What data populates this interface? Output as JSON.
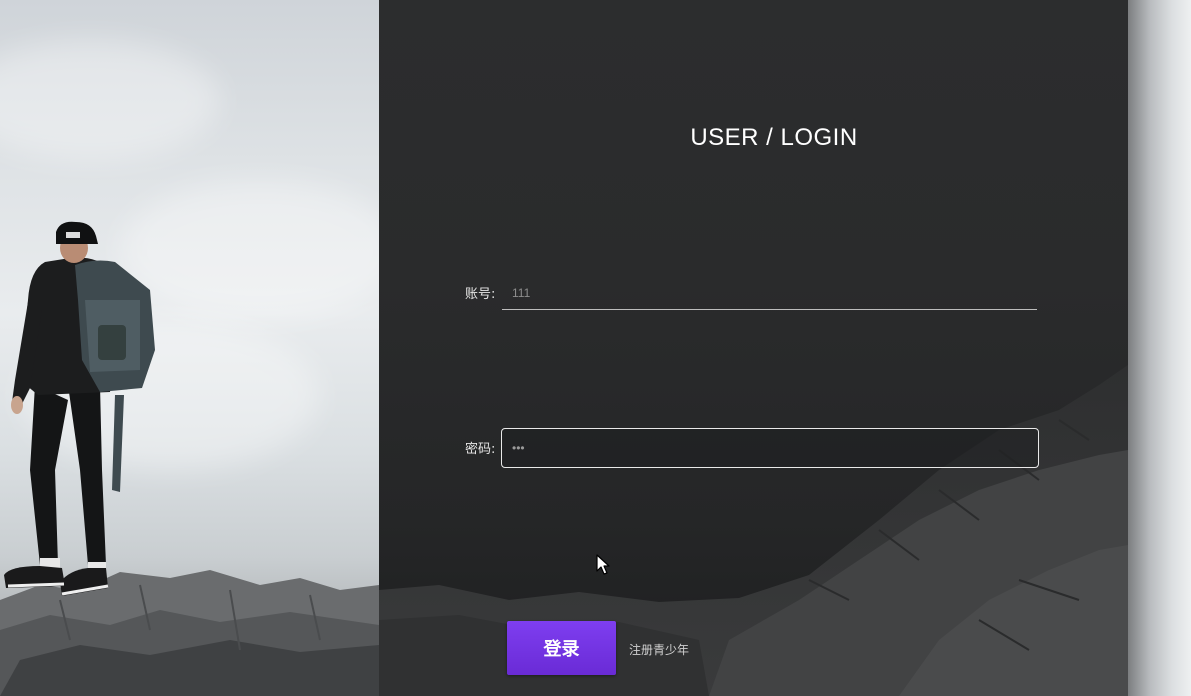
{
  "login": {
    "title": "USER / LOGIN",
    "account_label": "账号:",
    "account_value": "111",
    "password_label": "密码:",
    "password_value": "•••",
    "login_button": "登录",
    "register_link": "注册青少年"
  },
  "colors": {
    "accent": "#7a38ea",
    "panel_bg": "#2a2b2c",
    "text": "#ffffff"
  },
  "icons": [
    "cursor-icon"
  ]
}
